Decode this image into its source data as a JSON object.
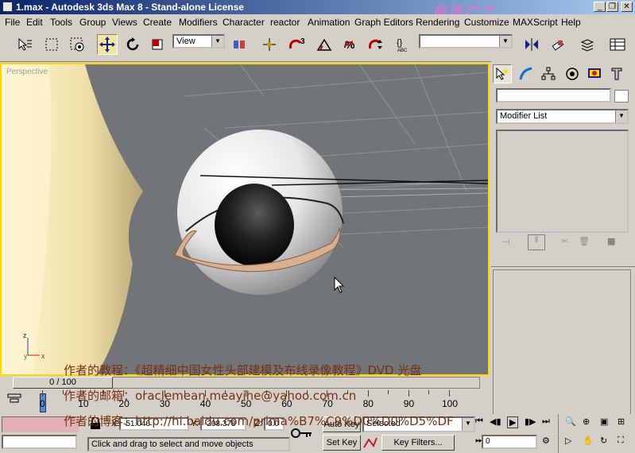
{
  "window": {
    "title": "1.max - Autodesk 3ds Max 8  - Stand-alone License",
    "watermark": "你活广了"
  },
  "menu": [
    "File",
    "Edit",
    "Tools",
    "Group",
    "Views",
    "Create",
    "Modifiers",
    "Character",
    "reactor",
    "Animation",
    "Graph Editors",
    "Rendering",
    "Customize",
    "MAXScript",
    "Help"
  ],
  "toolbar": {
    "reference_coord": "View",
    "named_selection": ""
  },
  "viewport": {
    "label": "Perspective",
    "axis_z": "z",
    "axis_y": "y",
    "axis_x": "x"
  },
  "command_panel": {
    "name_field": "",
    "modifier_list": "Modifier List"
  },
  "timeline": {
    "frame_counter": "0 / 100",
    "ticks": [
      "0",
      "10",
      "20",
      "30",
      "40",
      "50",
      "60",
      "70",
      "80",
      "90",
      "100"
    ]
  },
  "status": {
    "x_value": "-51.046",
    "y_value": "-208.378",
    "z_value": "0.0",
    "prompt": "Click and drag to select and move objects",
    "auto_key": "Auto Key",
    "set_key": "Set Key",
    "selected": "Selected",
    "key_filters": "Key Filters...",
    "frame": "0"
  },
  "overlay": {
    "line1": "作者的教程：《超精细中国女性头部建模及布线录像教程》DVD 光盘",
    "line2": "作者的邮箱：oraclemean.meayihe@yahoo.com.cn",
    "line3": "作者的博客：http://hi.baidu.com/prima%B7%C9%D0%D0%D5%DF"
  },
  "colors": {
    "viewport_border": "#ffd800",
    "viewport_bg": "#717578",
    "skin": "#f0e0a8",
    "title_start": "#0a246a"
  }
}
